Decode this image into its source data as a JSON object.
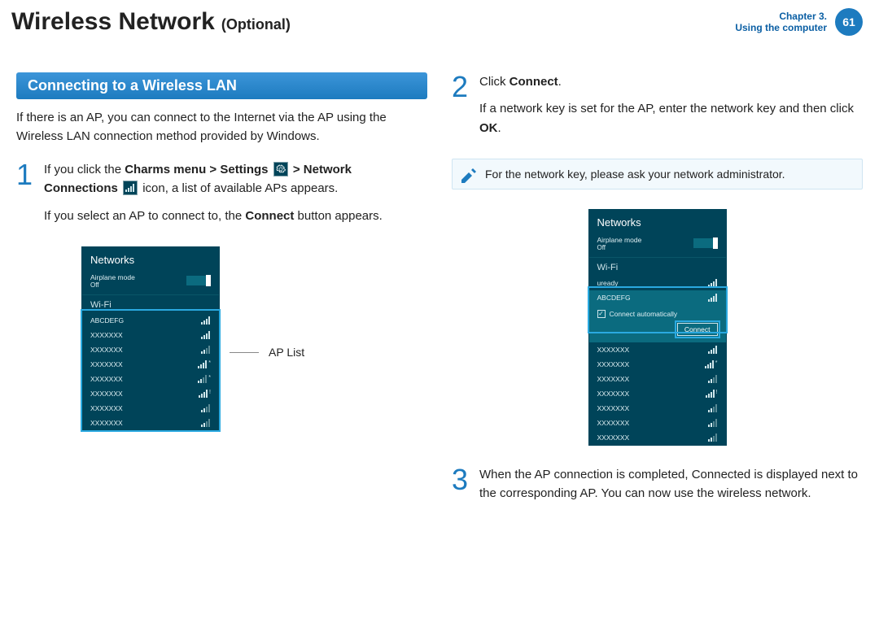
{
  "header": {
    "title": "Wireless Network",
    "subtitle": "(Optional)",
    "chapter_line1": "Chapter 3.",
    "chapter_line2": "Using the computer",
    "page_number": "61"
  },
  "left": {
    "section_heading": "Connecting to a Wireless LAN",
    "intro": "If there is an AP, you can connect to the Internet via the AP using the Wireless LAN connection method provided by Windows.",
    "step1": {
      "num": "1",
      "line1a": "If you click the ",
      "line1b_bold": "Charms menu > Settings ",
      "line1c_bold": " > Network Connections ",
      "line1d": " icon, a list of available APs appears.",
      "line2a": "If you select an AP to connect to, the ",
      "line2b_bold": "Connect",
      "line2c": " button appears."
    },
    "panel": {
      "title": "Networks",
      "airplane_label": "Airplane mode",
      "off": "Off",
      "wifi_label": "Wi-Fi",
      "items": [
        {
          "name": "ABCDEFG"
        },
        {
          "name": "XXXXXXX"
        },
        {
          "name": "XXXXXXX"
        },
        {
          "name": "XXXXXXX"
        },
        {
          "name": "XXXXXXX"
        },
        {
          "name": "XXXXXXX"
        },
        {
          "name": "XXXXXXX"
        },
        {
          "name": "XXXXXXX"
        }
      ]
    },
    "callout": "AP List"
  },
  "right": {
    "step2": {
      "num": "2",
      "line1a": "Click ",
      "line1b_bold": "Connect",
      "line1c": ".",
      "line2a": "If a network key is set for the AP, enter the network key and then click ",
      "line2b_bold": "OK",
      "line2c": "."
    },
    "note": "For the network key, please ask your network administrator.",
    "panel": {
      "title": "Networks",
      "airplane_label": "Airplane mode",
      "off": "Off",
      "wifi_label": "Wi-Fi",
      "uready": "uready",
      "selected": "ABCDEFG",
      "connect_auto": "Connect automatically",
      "connect_btn": "Connect",
      "items": [
        {
          "name": "XXXXXXX"
        },
        {
          "name": "XXXXXXX"
        },
        {
          "name": "XXXXXXX"
        },
        {
          "name": "XXXXXXX"
        },
        {
          "name": "XXXXXXX"
        },
        {
          "name": "XXXXXXX"
        },
        {
          "name": "XXXXXXX"
        }
      ]
    },
    "step3": {
      "num": "3",
      "text": "When the AP connection is completed, Connected is displayed next to the corresponding AP. You can now use the wireless network."
    }
  }
}
